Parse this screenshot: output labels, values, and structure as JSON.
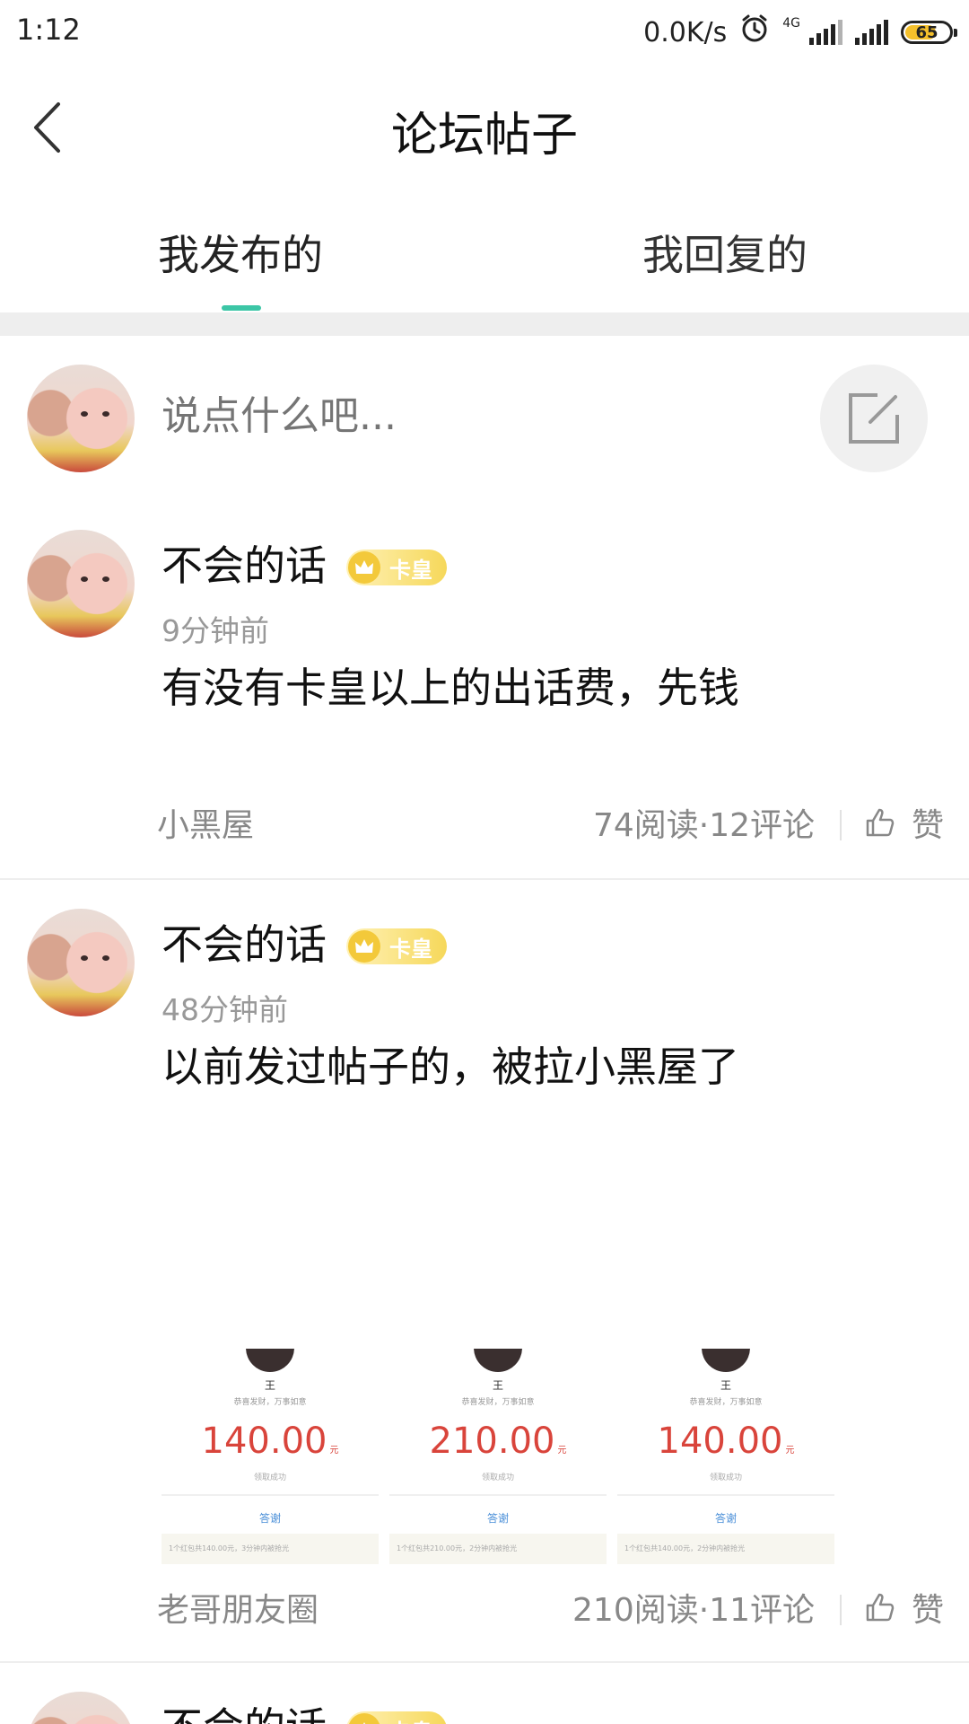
{
  "status_bar": {
    "time": "1:12",
    "net_speed": "0.0K/s",
    "network_type": "4G",
    "battery_level": "65"
  },
  "header": {
    "title": "论坛帖子",
    "back_icon": "chevron-left-icon"
  },
  "tabs": [
    {
      "label": "我发布的",
      "active": true
    },
    {
      "label": "我回复的",
      "active": false
    }
  ],
  "compose": {
    "placeholder": "说点什么吧...",
    "icon": "edit-icon"
  },
  "posts": [
    {
      "author": "不会的话",
      "badge": "卡皇",
      "time": "9分钟前",
      "content": "有没有卡皇以上的出话费，先钱",
      "category": "小黑屋",
      "stats": "74阅读·12评论",
      "like_label": "赞"
    },
    {
      "author": "不会的话",
      "badge": "卡皇",
      "time": "48分钟前",
      "content": "以前发过帖子的，被拉小黑屋了",
      "images": [
        {
          "name": "王",
          "wish": "恭喜发财，万事如意",
          "amount": "140.00",
          "unit": "元",
          "status": "领取成功",
          "thanks": "答谢",
          "note": "1个红包共140.00元，3分钟内被抢光"
        },
        {
          "name": "王",
          "wish": "恭喜发财，万事如意",
          "amount": "210.00",
          "unit": "元",
          "status": "领取成功",
          "thanks": "答谢",
          "note": "1个红包共210.00元，2分钟内被抢光"
        },
        {
          "name": "王",
          "wish": "恭喜发财，万事如意",
          "amount": "140.00",
          "unit": "元",
          "status": "领取成功",
          "thanks": "答谢",
          "note": "1个红包共140.00元，2分钟内被抢光"
        }
      ],
      "category": "老哥朋友圈",
      "stats": "210阅读·11评论",
      "like_label": "赞"
    },
    {
      "author": "不会的话",
      "badge": "卡皇"
    }
  ]
}
